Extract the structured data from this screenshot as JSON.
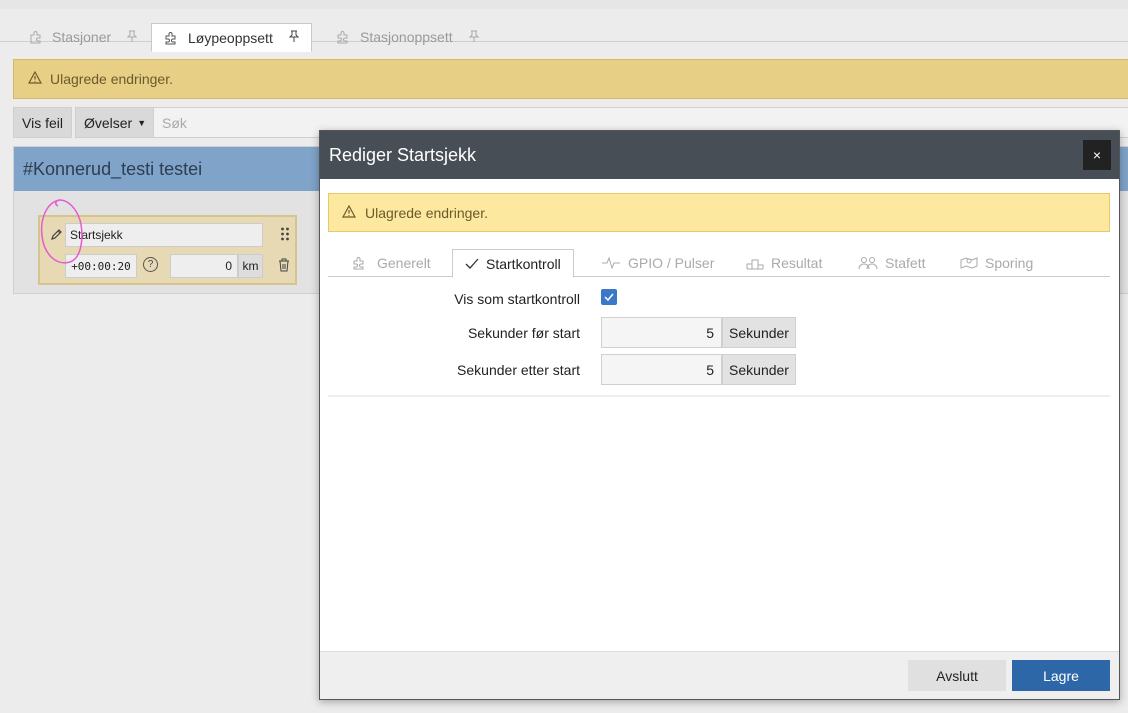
{
  "tabs": [
    {
      "label": "Stasjoner",
      "icon": "puzzle-icon",
      "active": false
    },
    {
      "label": "Løypeoppsett",
      "icon": "puzzle-icon",
      "active": true
    },
    {
      "label": "Stasjonoppsett",
      "icon": "puzzle-icon",
      "active": false
    }
  ],
  "warning": {
    "text": "Ulagrede endringer."
  },
  "toolbar": {
    "errors_label": "Vis feil",
    "exercises_label": "Øvelser",
    "search_placeholder": "Søk"
  },
  "course": {
    "title": "#Konnerud_testi testei",
    "station": {
      "name": "Startsjekk",
      "time": "+00:00:20",
      "distance": "0",
      "distance_unit": "km"
    }
  },
  "modal": {
    "title": "Rediger Startsjekk",
    "close_label": "×",
    "warning": "Ulagrede endringer.",
    "tabs": [
      {
        "label": "Generelt",
        "icon": "puzzle-icon"
      },
      {
        "label": "Startkontroll",
        "icon": "check-icon",
        "active": true
      },
      {
        "label": "GPIO / Pulser",
        "icon": "pulse-icon"
      },
      {
        "label": "Resultat",
        "icon": "podium-icon"
      },
      {
        "label": "Stafett",
        "icon": "people-icon"
      },
      {
        "label": "Sporing",
        "icon": "map-icon"
      }
    ],
    "fields": {
      "show_as_start": {
        "label": "Vis som startkontroll",
        "checked": true
      },
      "seconds_before": {
        "label": "Sekunder før start",
        "value": "5",
        "unit": "Sekunder"
      },
      "seconds_after": {
        "label": "Sekunder etter start",
        "value": "5",
        "unit": "Sekunder"
      }
    },
    "buttons": {
      "cancel": "Avslutt",
      "save": "Lagre"
    }
  },
  "colors": {
    "accent": "#2e67a8",
    "header": "#484e55",
    "warning_bg": "#fde8a0",
    "course_header": "#7fa3c9"
  }
}
